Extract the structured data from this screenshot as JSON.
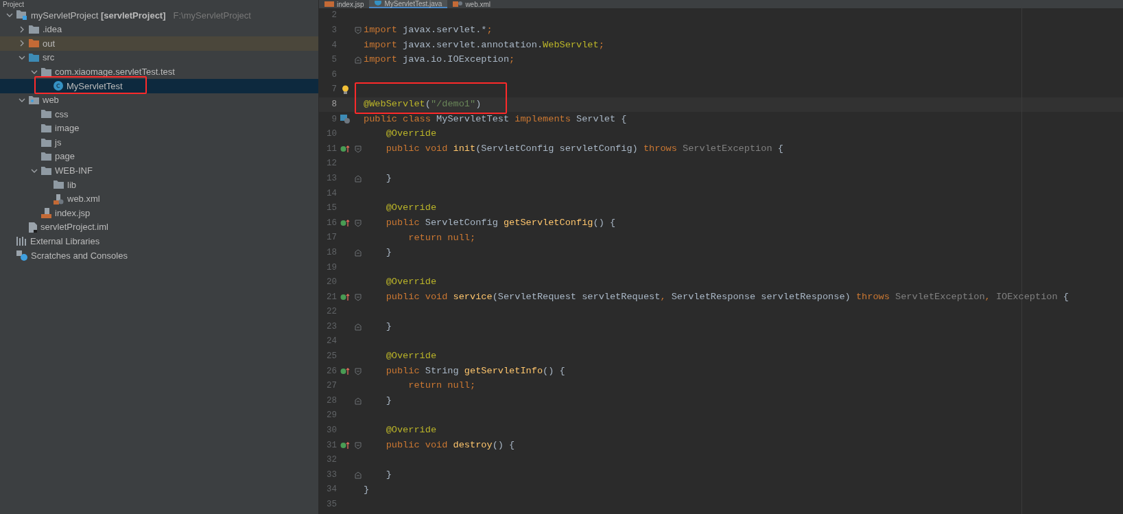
{
  "project_panel": {
    "title": "Project"
  },
  "editor_tabs": [
    {
      "label": "index.jsp",
      "kind": "jsp",
      "selected": false
    },
    {
      "label": "MyServletTest.java",
      "kind": "class",
      "selected": true
    },
    {
      "label": "web.xml",
      "kind": "xml",
      "selected": false
    }
  ],
  "tree": [
    {
      "label": "myServletProject **[servletProject]**",
      "path": "F:\\myServletProject",
      "kind": "module",
      "expanded": true,
      "selected": false,
      "children": [
        {
          "label": ".idea",
          "kind": "folder",
          "expanded": false,
          "selected": false
        },
        {
          "label": "out",
          "kind": "folder-excluded",
          "expanded": false,
          "selected": false,
          "tinted": true
        },
        {
          "label": "src",
          "kind": "folder-source",
          "expanded": true,
          "selected": false,
          "children": [
            {
              "label": "com.xiaomage.servletTest.test",
              "kind": "package",
              "expanded": true,
              "selected": false,
              "children": [
                {
                  "label": "MyServletTest",
                  "kind": "class",
                  "selected": true,
                  "marked": true
                }
              ]
            }
          ]
        },
        {
          "label": "web",
          "kind": "folder-web",
          "expanded": true,
          "selected": false,
          "children": [
            {
              "label": "css",
              "kind": "folder",
              "selected": false
            },
            {
              "label": "image",
              "kind": "folder",
              "selected": false
            },
            {
              "label": "js",
              "kind": "folder",
              "selected": false
            },
            {
              "label": "page",
              "kind": "folder",
              "selected": false
            },
            {
              "label": "WEB-INF",
              "kind": "folder",
              "expanded": true,
              "selected": false,
              "children": [
                {
                  "label": "lib",
                  "kind": "folder",
                  "selected": false
                },
                {
                  "label": "web.xml",
                  "kind": "xml",
                  "selected": false
                }
              ]
            },
            {
              "label": "index.jsp",
              "kind": "jsp",
              "selected": false
            }
          ]
        },
        {
          "label": "servletProject.iml",
          "kind": "iml",
          "selected": false
        }
      ]
    },
    {
      "label": "External Libraries",
      "kind": "libraries",
      "selected": false
    },
    {
      "label": "Scratches and Consoles",
      "kind": "scratches",
      "selected": false
    }
  ],
  "code_lines": [
    {
      "number": "2"
    },
    {
      "number": "3",
      "fold": {
        "kind": "start"
      },
      "tokens": [
        {
          "kind": "keyword",
          "text": "import"
        },
        {
          "kind": "plain",
          "text": " javax.servlet.*"
        },
        {
          "kind": "keyword",
          "text": ";"
        }
      ]
    },
    {
      "number": "4",
      "tokens": [
        {
          "kind": "keyword",
          "text": "import"
        },
        {
          "kind": "plain",
          "text": " javax.servlet.annotation."
        },
        {
          "kind": "annotation",
          "text": "WebServlet"
        },
        {
          "kind": "keyword",
          "text": ";"
        }
      ]
    },
    {
      "number": "5",
      "fold": {
        "kind": "end"
      },
      "tokens": [
        {
          "kind": "keyword",
          "text": "import"
        },
        {
          "kind": "plain",
          "text": " java.io.IOException"
        },
        {
          "kind": "keyword",
          "text": ";"
        }
      ]
    },
    {
      "number": "6"
    },
    {
      "number": "7",
      "gutter": {
        "kind": "bulb"
      }
    },
    {
      "number": "8",
      "current": true,
      "marked": true,
      "tokens": [
        {
          "kind": "annotation",
          "text": "@WebServlet"
        },
        {
          "kind": "plain",
          "text": "("
        },
        {
          "kind": "string",
          "text": "\"/demo1\""
        },
        {
          "kind": "plain",
          "text": ")"
        }
      ]
    },
    {
      "number": "9",
      "gutter": {
        "kind": "servlet"
      },
      "tokens": [
        {
          "kind": "keyword",
          "text": "public class "
        },
        {
          "kind": "plain",
          "text": "MyServletTest "
        },
        {
          "kind": "keyword",
          "text": "implements "
        },
        {
          "kind": "plain",
          "text": "Servlet {"
        }
      ]
    },
    {
      "number": "10",
      "tokens": [
        {
          "kind": "annotation",
          "text": "    @Override"
        }
      ]
    },
    {
      "number": "11",
      "gutter": {
        "kind": "implements"
      },
      "fold": {
        "kind": "start"
      },
      "tokens": [
        {
          "kind": "keyword",
          "text": "    public void "
        },
        {
          "kind": "method",
          "text": "init"
        },
        {
          "kind": "plain",
          "text": "(ServletConfig servletConfig) "
        },
        {
          "kind": "keyword",
          "text": "throws "
        },
        {
          "kind": "unused",
          "text": "ServletException"
        },
        {
          "kind": "plain",
          "text": " {"
        }
      ]
    },
    {
      "number": "12"
    },
    {
      "number": "13",
      "fold": {
        "kind": "end"
      },
      "tokens": [
        {
          "kind": "plain",
          "text": "    }"
        }
      ]
    },
    {
      "number": "14"
    },
    {
      "number": "15",
      "tokens": [
        {
          "kind": "annotation",
          "text": "    @Override"
        }
      ]
    },
    {
      "number": "16",
      "gutter": {
        "kind": "implements"
      },
      "fold": {
        "kind": "start"
      },
      "tokens": [
        {
          "kind": "keyword",
          "text": "    public "
        },
        {
          "kind": "plain",
          "text": "ServletConfig "
        },
        {
          "kind": "method",
          "text": "getServletConfig"
        },
        {
          "kind": "plain",
          "text": "() {"
        }
      ]
    },
    {
      "number": "17",
      "tokens": [
        {
          "kind": "keyword",
          "text": "        return null;"
        }
      ]
    },
    {
      "number": "18",
      "fold": {
        "kind": "end"
      },
      "tokens": [
        {
          "kind": "plain",
          "text": "    }"
        }
      ]
    },
    {
      "number": "19"
    },
    {
      "number": "20",
      "tokens": [
        {
          "kind": "annotation",
          "text": "    @Override"
        }
      ]
    },
    {
      "number": "21",
      "gutter": {
        "kind": "implements"
      },
      "fold": {
        "kind": "start"
      },
      "tokens": [
        {
          "kind": "keyword",
          "text": "    public void "
        },
        {
          "kind": "method",
          "text": "service"
        },
        {
          "kind": "plain",
          "text": "(ServletRequest servletRequest"
        },
        {
          "kind": "keyword",
          "text": ", "
        },
        {
          "kind": "plain",
          "text": "ServletResponse servletResponse) "
        },
        {
          "kind": "keyword",
          "text": "throws "
        },
        {
          "kind": "unused",
          "text": "ServletException"
        },
        {
          "kind": "keyword",
          "text": ", "
        },
        {
          "kind": "unused",
          "text": "IOException"
        },
        {
          "kind": "plain",
          "text": " {"
        }
      ]
    },
    {
      "number": "22"
    },
    {
      "number": "23",
      "fold": {
        "kind": "end"
      },
      "tokens": [
        {
          "kind": "plain",
          "text": "    }"
        }
      ]
    },
    {
      "number": "24"
    },
    {
      "number": "25",
      "tokens": [
        {
          "kind": "annotation",
          "text": "    @Override"
        }
      ]
    },
    {
      "number": "26",
      "gutter": {
        "kind": "implements"
      },
      "fold": {
        "kind": "start"
      },
      "tokens": [
        {
          "kind": "keyword",
          "text": "    public "
        },
        {
          "kind": "plain",
          "text": "String "
        },
        {
          "kind": "method",
          "text": "getServletInfo"
        },
        {
          "kind": "plain",
          "text": "() {"
        }
      ]
    },
    {
      "number": "27",
      "tokens": [
        {
          "kind": "keyword",
          "text": "        return null;"
        }
      ]
    },
    {
      "number": "28",
      "fold": {
        "kind": "end"
      },
      "tokens": [
        {
          "kind": "plain",
          "text": "    }"
        }
      ]
    },
    {
      "number": "29"
    },
    {
      "number": "30",
      "tokens": [
        {
          "kind": "annotation",
          "text": "    @Override"
        }
      ]
    },
    {
      "number": "31",
      "gutter": {
        "kind": "implements"
      },
      "fold": {
        "kind": "start"
      },
      "tokens": [
        {
          "kind": "keyword",
          "text": "    public void "
        },
        {
          "kind": "method",
          "text": "destroy"
        },
        {
          "kind": "plain",
          "text": "() {"
        }
      ]
    },
    {
      "number": "32"
    },
    {
      "number": "33",
      "fold": {
        "kind": "end"
      },
      "tokens": [
        {
          "kind": "plain",
          "text": "    }"
        }
      ]
    },
    {
      "number": "34",
      "tokens": [
        {
          "kind": "plain",
          "text": "}"
        }
      ]
    },
    {
      "number": "35"
    }
  ]
}
